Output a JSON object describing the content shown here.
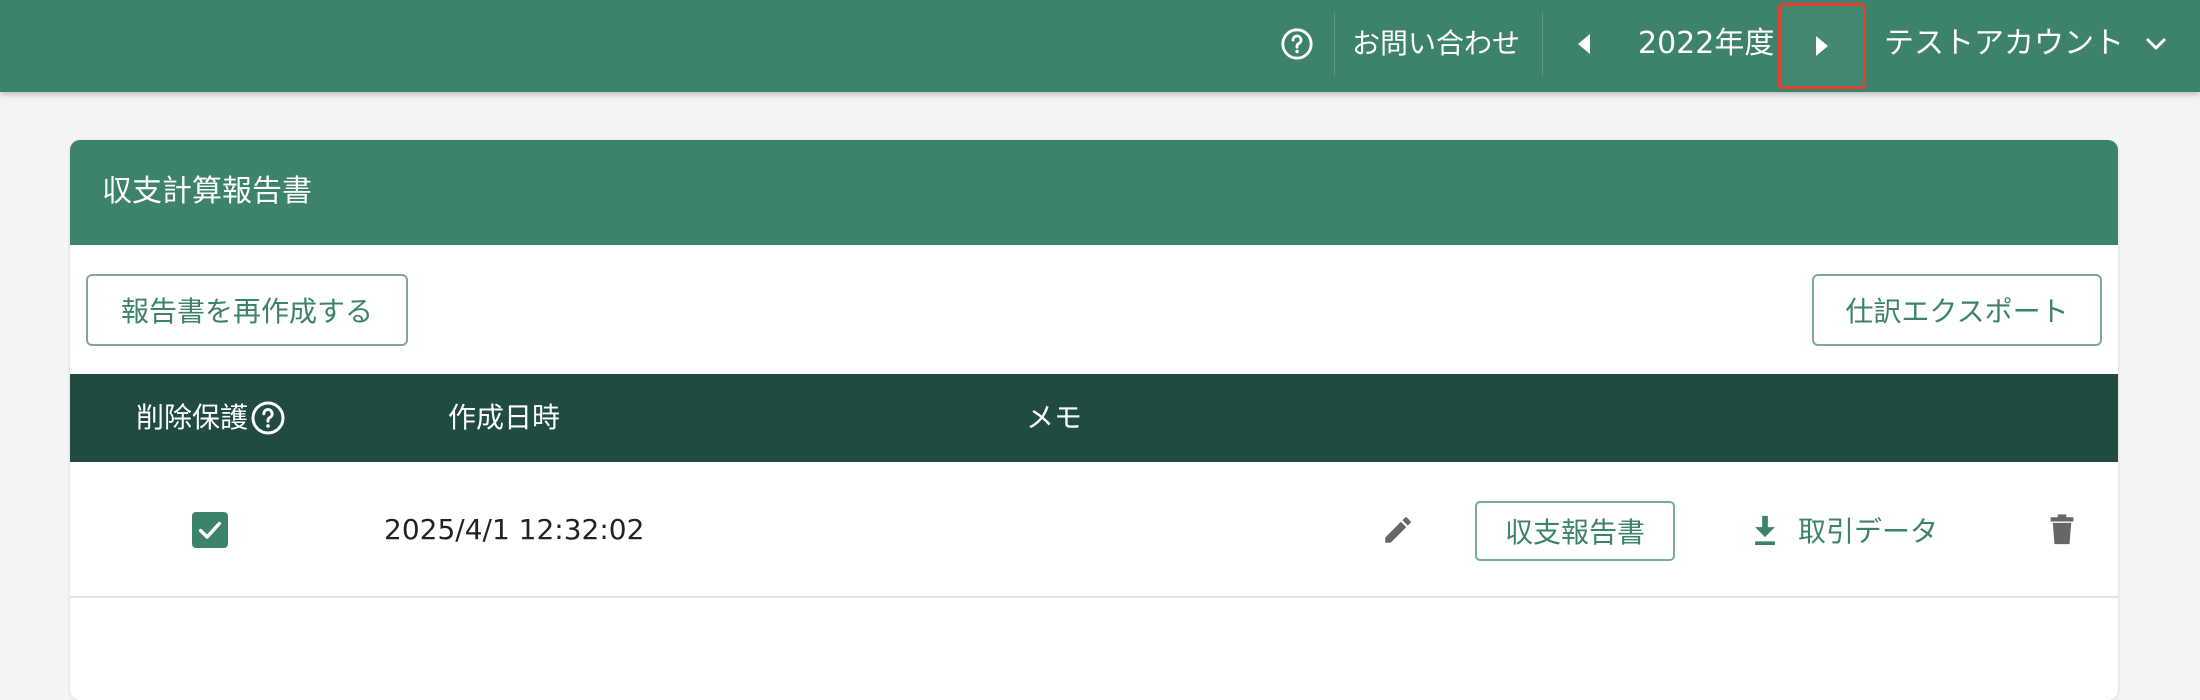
{
  "header": {
    "help_icon": "help-circle-icon",
    "contact_label": "お問い合わせ",
    "prev_year_icon": "caret-left-icon",
    "fiscal_year": "2022年度",
    "next_year_icon": "caret-right-icon",
    "account_name": "テストアカウント",
    "account_menu_icon": "chevron-down-icon"
  },
  "card": {
    "title": "収支計算報告書",
    "recreate_button": "報告書を再作成する",
    "export_button": "仕訳エクスポート"
  },
  "table": {
    "columns": [
      "削除保護",
      "作成日時",
      "メモ"
    ],
    "rows": [
      {
        "protected": true,
        "created_at": "2025/4/1 12:32:02",
        "memo": "",
        "report_button": "収支報告書",
        "download_label": "取引データ"
      }
    ]
  },
  "colors": {
    "primary": "#3c826c",
    "table_header": "#1f4b40",
    "highlight": "#e0432e"
  }
}
